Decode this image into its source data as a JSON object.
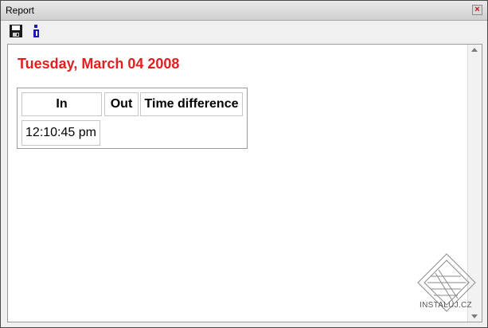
{
  "window": {
    "title": "Report"
  },
  "toolbar": {
    "save_icon": "save-icon",
    "info_icon": "info-icon"
  },
  "report": {
    "date": "Tuesday, March 04 2008",
    "columns": [
      "In",
      "Out",
      "Time difference"
    ],
    "rows": [
      {
        "in": "12:10:45 pm",
        "out": "",
        "diff": ""
      }
    ]
  },
  "watermark": {
    "text": "INSTALUJ.CZ"
  },
  "colors": {
    "date_red": "#e02020"
  }
}
